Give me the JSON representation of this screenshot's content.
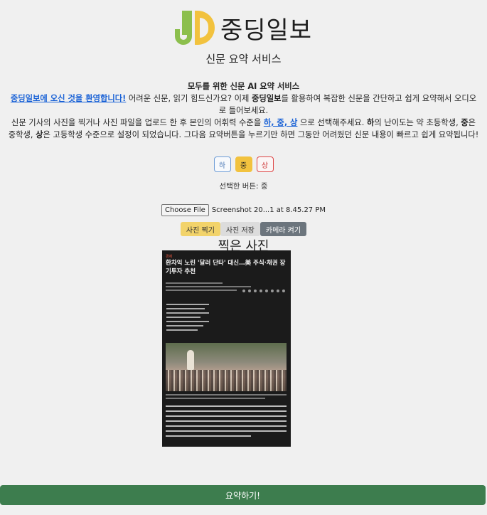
{
  "brand": {
    "name": "중딩일보"
  },
  "subtitle": "신문 요약 서비스",
  "intro": {
    "headline": "모두를 위한 신문 AI 요약 서비스",
    "welcome_link": "중딩일보에 오신 것을 환영합니다!",
    "line1_a": " 어려운 신문, 읽기 힘드신가요? 이제 ",
    "line1_brand": "중딩일보",
    "line1_b": "를 활용하여 복잡한 신문을 간단하고 쉽게 요약해서 오디오로 들어보세요.",
    "line2_a": "신문 기사의 사진을 찍거나 사진 파일을 업로드 한 후 본인의 어휘력 수준을 ",
    "line2_levels": "하, 중, 상",
    "line2_b": " 으로 선택해주세요. ",
    "l_low": "하",
    "line2_c": "의 난이도는 약 초등학생, ",
    "l_mid": "중",
    "line2_d": "은 중학생, ",
    "l_high": "상",
    "line2_e": "은 고등학생 수준으로 설정이 되었습니다. 그다음 요약버튼을 누르기만 하면 그동안 어려웠던 신문 내용이 빠르고 쉽게 요약됩니다!"
  },
  "levels": {
    "low": "하",
    "mid": "중",
    "high": "상"
  },
  "selected_text": "선택한 버튼: 중",
  "file": {
    "button": "Choose File",
    "filename": "Screenshot 20...1 at 8.45.27 PM"
  },
  "actions": {
    "photo": "사진 찍기",
    "save": "사진 저장",
    "camera": "카메라 켜기"
  },
  "taken_title": "찍은 사진",
  "photo": {
    "category": "경제",
    "title": "환차익 노린 '달러 단타' 대신…美 주식·채권 장기투자 추천"
  },
  "submit": "요약하기!",
  "colors": {
    "accent_green": "#3d7d4e",
    "yellow": "#f2c23e",
    "logo_green": "#8cbf4d",
    "link_blue": "#1a62d6"
  }
}
